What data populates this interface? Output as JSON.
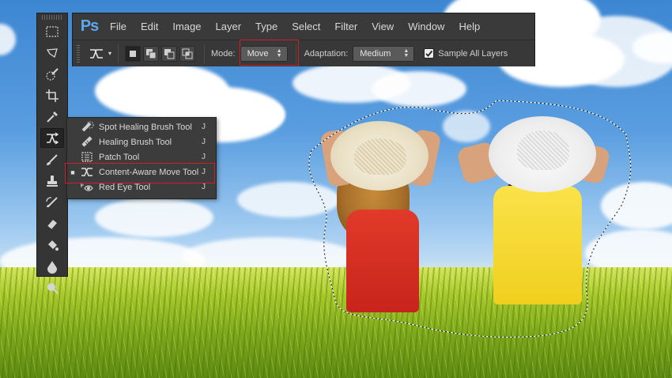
{
  "app": {
    "logo": "Ps",
    "menu": [
      "File",
      "Edit",
      "Image",
      "Layer",
      "Type",
      "Select",
      "Filter",
      "View",
      "Window",
      "Help"
    ]
  },
  "options_bar": {
    "mode_label": "Mode:",
    "mode_value": "Move",
    "adaptation_label": "Adaptation:",
    "adaptation_value": "Medium",
    "sample_all_layers_label": "Sample All Layers",
    "sample_all_layers_checked": true
  },
  "toolbar": {
    "tools": [
      "rectangular-marquee-icon",
      "lasso-icon",
      "quick-selection-icon",
      "crop-icon",
      "eyedropper-icon",
      "content-aware-move-icon",
      "brush-icon",
      "clone-stamp-icon",
      "history-brush-icon",
      "eraser-icon",
      "paint-bucket-icon",
      "blur-icon",
      "dodge-icon"
    ],
    "active_tool": "content-aware-move-icon"
  },
  "flyout": {
    "items": [
      {
        "label": "Spot Healing Brush Tool",
        "shortcut": "J",
        "icon": "spot-healing-brush-icon",
        "selected": false
      },
      {
        "label": "Healing Brush Tool",
        "shortcut": "J",
        "icon": "healing-brush-icon",
        "selected": false
      },
      {
        "label": "Patch Tool",
        "shortcut": "J",
        "icon": "patch-icon",
        "selected": false
      },
      {
        "label": "Content-Aware Move Tool",
        "shortcut": "J",
        "icon": "content-aware-move-icon",
        "selected": true
      },
      {
        "label": "Red Eye Tool",
        "shortcut": "J",
        "icon": "red-eye-icon",
        "selected": false
      }
    ]
  },
  "colors": {
    "highlight": "#d21c2a",
    "chrome": "#3b3b3b",
    "ps_blue": "#5aa9f0"
  }
}
